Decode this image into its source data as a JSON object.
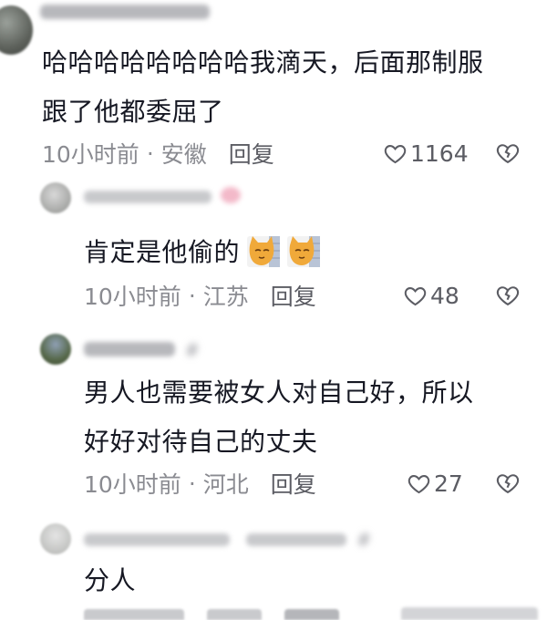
{
  "comments": [
    {
      "body_lines": [
        "哈哈哈哈哈哈哈哈我滴天，后面那制服",
        "跟了他都委屈了"
      ],
      "time": "10小时前",
      "separator": "·",
      "location": "安徽",
      "reply_label": "回复",
      "likes": "1164",
      "icons": {
        "like": "heart-outline-icon",
        "dislike": "broken-heart-icon"
      }
    },
    {
      "body_lines": [
        "肯定是他偷的"
      ],
      "emoji": [
        "cat-face-emoji",
        "cat-face-emoji"
      ],
      "time": "10小时前",
      "separator": "·",
      "location": "江苏",
      "reply_label": "回复",
      "likes": "48",
      "icons": {
        "like": "heart-outline-icon",
        "dislike": "broken-heart-icon"
      }
    },
    {
      "body_lines": [
        "男人也需要被女人对自己好，所以",
        "好好对待自己的丈夫"
      ],
      "time": "10小时前",
      "separator": "·",
      "location": "河北",
      "reply_label": "回复",
      "likes": "27",
      "icons": {
        "like": "heart-outline-icon",
        "dislike": "broken-heart-icon"
      }
    },
    {
      "body_lines": [
        "分人"
      ]
    }
  ],
  "colors": {
    "text": "#161823",
    "meta": "#8a8b91",
    "reply": "#5b5c63",
    "background": "#ffffff"
  }
}
